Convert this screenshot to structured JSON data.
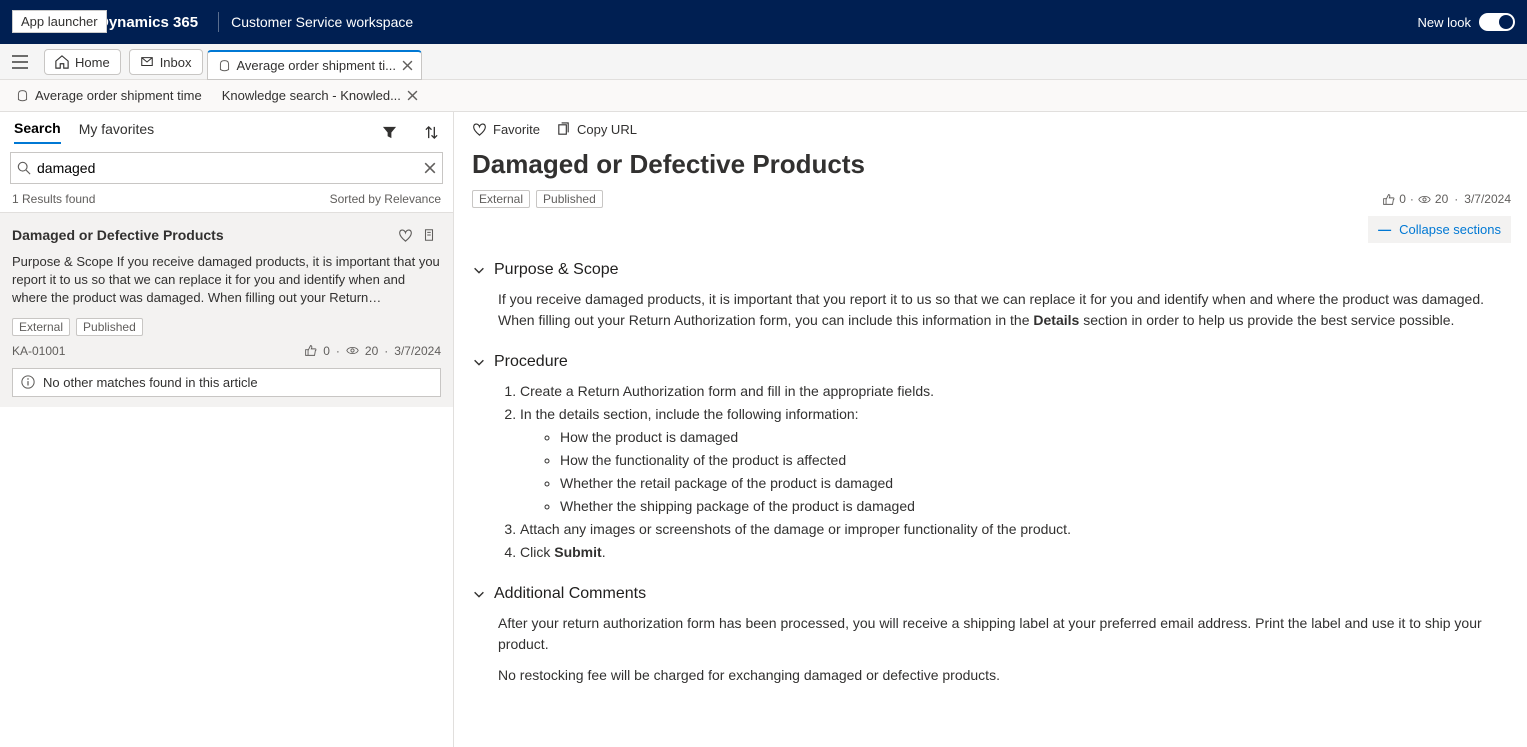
{
  "tooltip": {
    "app_launcher": "App launcher"
  },
  "topbar": {
    "brand": "Dynamics 365",
    "workspace": "Customer Service workspace",
    "newlook": "New look"
  },
  "tabs": {
    "home": "Home",
    "inbox": "Inbox",
    "active": "Average order shipment ti..."
  },
  "subtabs": {
    "case": "Average order shipment time",
    "ksearch": "Knowledge search - Knowled..."
  },
  "left": {
    "tab_search": "Search",
    "tab_fav": "My favorites",
    "search_value": "damaged",
    "results_found": "1 Results found",
    "sorted_by": "Sorted by Relevance",
    "card": {
      "title": "Damaged or Defective Products",
      "snippet": "Purpose & Scope If you receive damaged products, it is important that you report it to us so that we can replace it for you and identify when and where the product was damaged. When filling out your Return…",
      "badge1": "External",
      "badge2": "Published",
      "id": "KA-01001",
      "likes": "0",
      "views": "20",
      "date": "3/7/2024"
    },
    "no_more": "No other matches found in this article"
  },
  "article": {
    "favorite": "Favorite",
    "copyurl": "Copy URL",
    "title": "Damaged or Defective Products",
    "badge1": "External",
    "badge2": "Published",
    "likes": "0",
    "views": "20",
    "date": "3/7/2024",
    "collapse": "Collapse sections",
    "sec1": {
      "title": "Purpose & Scope",
      "p1a": "If you receive damaged products, it is important that you report it to us so that we can replace it for you and identify when and where the product was damaged. When filling out your Return Authorization form, you can include this information in the ",
      "p1b": "Details",
      "p1c": " section in order to help us provide the best service possible."
    },
    "sec2": {
      "title": "Procedure",
      "s1": "Create a Return Authorization form and fill in the appropriate fields.",
      "s2": "In the details section, include the following information:",
      "b1": "How the product is damaged",
      "b2": "How the functionality of the product is affected",
      "b3": "Whether the retail package of the product is damaged",
      "b4": "Whether the shipping package of the product is damaged",
      "s3": "Attach any images or screenshots of the damage or improper functionality of the product.",
      "s4a": "Click ",
      "s4b": "Submit",
      "s4c": "."
    },
    "sec3": {
      "title": "Additional Comments",
      "p1": "After your return authorization form has been processed, you will receive a shipping label at your preferred email address. Print the label and use it to ship your product.",
      "p2": "No restocking fee will be charged for exchanging damaged or defective products."
    }
  }
}
